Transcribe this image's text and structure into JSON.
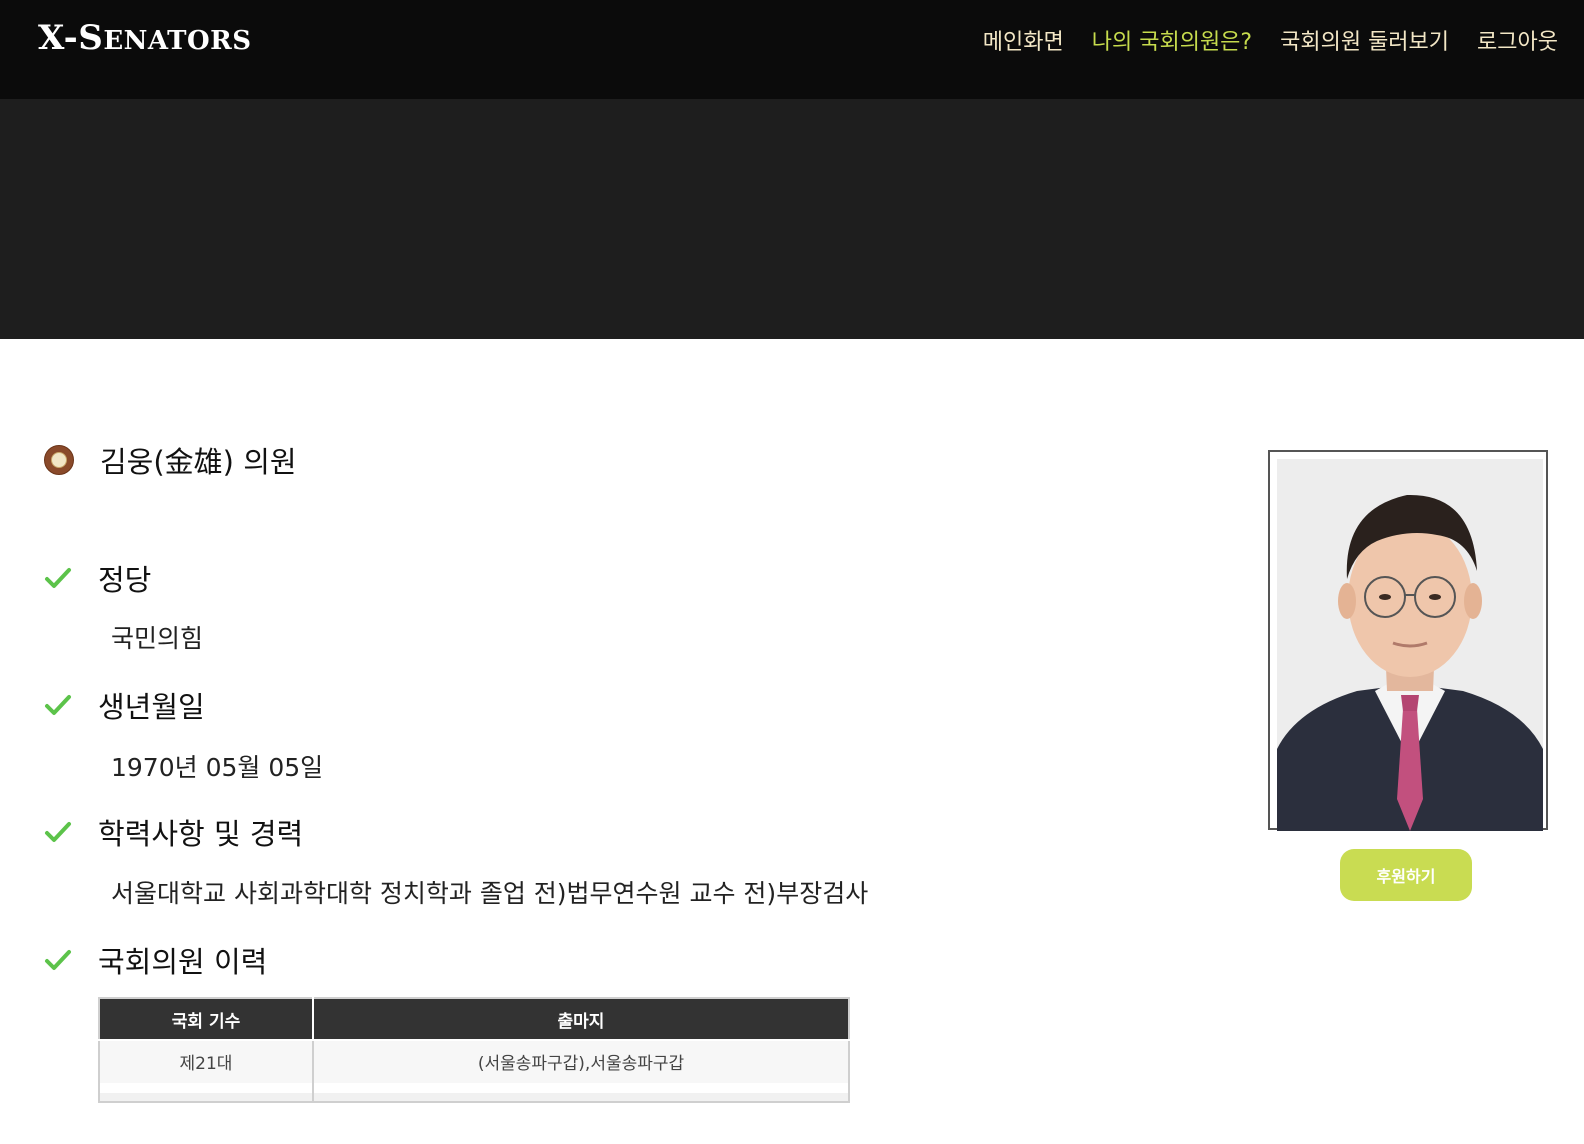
{
  "brand": {
    "first": "X-S",
    "rest": "ENATORS"
  },
  "nav": {
    "items": [
      {
        "label": "메인화면"
      },
      {
        "label": "나의 국회의원은?"
      },
      {
        "label": "국회의원 둘러보기"
      },
      {
        "label": "로그아웃"
      }
    ]
  },
  "member": {
    "name": "김웅(金雄) 의원",
    "emblem_icon": "national-assembly-emblem-icon"
  },
  "sections": {
    "party": {
      "title": "정당",
      "value": "국민의힘"
    },
    "birth": {
      "title": "생년월일",
      "value": "1970년 05월 05일"
    },
    "career": {
      "title": "학력사항 및 경력",
      "value": "서울대학교 사회과학대학 정치학과 졸업 전)법무연수원 교수 전)부장검사"
    },
    "history": {
      "title": "국회의원 이력"
    }
  },
  "history_table": {
    "headers": [
      "국회 기수",
      "출마지"
    ],
    "rows": [
      [
        "제21대",
        "(서울송파구갑),서울송파구갑"
      ]
    ]
  },
  "sponsor_button": {
    "label": "후원하기"
  },
  "colors": {
    "nav_text": "#f3e7c6",
    "nav_active": "#c7dc4d",
    "check": "#5cc34a",
    "sponsor_bg": "#c9dc52",
    "header_bg": "#0b0b0b",
    "hero_bg": "#1e1e1e"
  }
}
